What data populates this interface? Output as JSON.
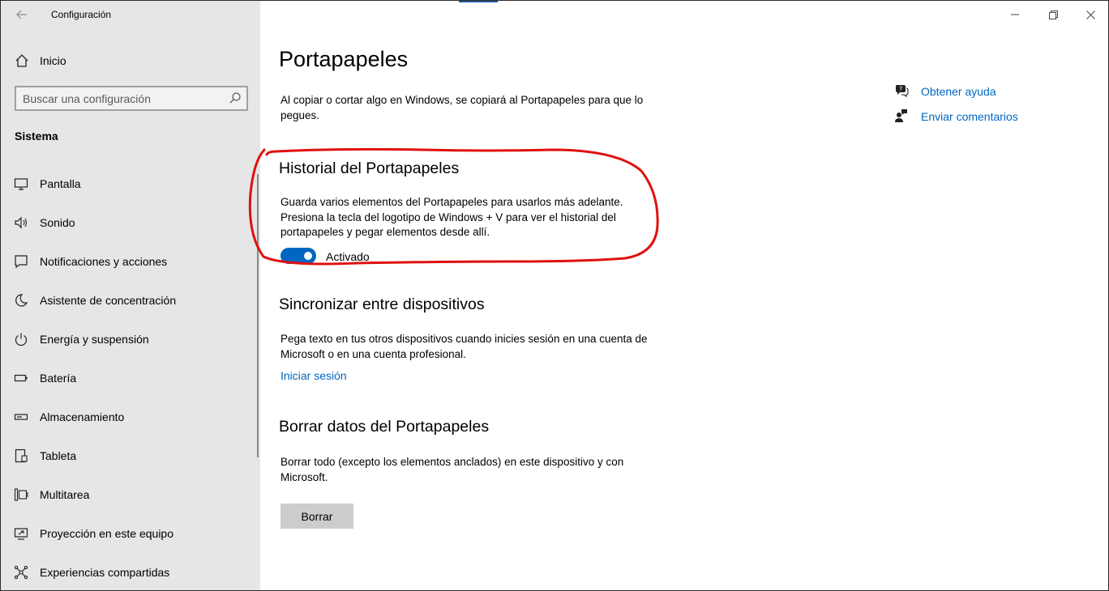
{
  "window": {
    "title": "Configuración",
    "controls": {
      "minimize": "—",
      "restore": "❐",
      "close": "✕"
    }
  },
  "sidebar": {
    "home_label": "Inicio",
    "search_placeholder": "Buscar una configuración",
    "section_title": "Sistema",
    "items": [
      {
        "label": "Pantalla",
        "icon": "monitor-icon"
      },
      {
        "label": "Sonido",
        "icon": "speaker-icon"
      },
      {
        "label": "Notificaciones y acciones",
        "icon": "notification-icon"
      },
      {
        "label": "Asistente de concentración",
        "icon": "moon-icon"
      },
      {
        "label": "Energía y suspensión",
        "icon": "power-icon"
      },
      {
        "label": "Batería",
        "icon": "battery-icon"
      },
      {
        "label": "Almacenamiento",
        "icon": "storage-icon"
      },
      {
        "label": "Tableta",
        "icon": "tablet-icon"
      },
      {
        "label": "Multitarea",
        "icon": "multitask-icon"
      },
      {
        "label": "Proyección en este equipo",
        "icon": "projection-icon"
      },
      {
        "label": "Experiencias compartidas",
        "icon": "shared-experiences-icon"
      }
    ]
  },
  "main": {
    "title": "Portapapeles",
    "intro": "Al copiar o cortar algo en Windows, se copiará al Portapapeles para que lo pegues.",
    "history": {
      "heading": "Historial del Portapapeles",
      "description": "Guarda varios elementos del Portapapeles para usarlos más adelante. Presiona la tecla del logotipo de Windows + V para ver el historial del portapapeles y pegar elementos desde allí.",
      "toggle_state": "Activado",
      "toggle_on": true
    },
    "sync": {
      "heading": "Sincronizar entre dispositivos",
      "description": "Pega texto en tus otros dispositivos cuando inicies sesión en una cuenta de Microsoft o en una cuenta profesional.",
      "link": "Iniciar sesión"
    },
    "clear": {
      "heading": "Borrar datos del Portapapeles",
      "description": "Borrar todo (excepto los elementos anclados) en este dispositivo y con Microsoft.",
      "button": "Borrar"
    }
  },
  "help": {
    "get_help": "Obtener ayuda",
    "feedback": "Enviar comentarios"
  },
  "colors": {
    "accent": "#0067c0",
    "sidebar_bg": "#e6e6e6",
    "annotation": "#e01010"
  }
}
